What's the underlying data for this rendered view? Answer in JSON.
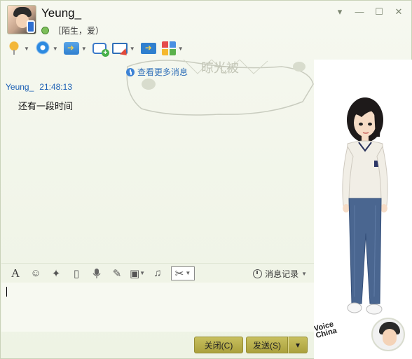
{
  "contact": {
    "nickname": "Yeung_",
    "signature": "［陌生，爱）"
  },
  "window_controls": [
    "▾",
    "—",
    "☐",
    "✕"
  ],
  "toolbar": {
    "items": [
      {
        "icon": "microphone-icon",
        "has_dropdown": true
      },
      {
        "icon": "webcam-icon",
        "has_dropdown": true
      },
      {
        "icon": "send-file-icon",
        "has_dropdown": true
      },
      {
        "icon": "create-group-chat-icon",
        "has_dropdown": false
      },
      {
        "icon": "remote-assist-icon",
        "has_dropdown": true
      },
      {
        "icon": "share-screen-icon",
        "has_dropdown": false
      },
      {
        "icon": "apps-icon",
        "has_dropdown": true
      }
    ]
  },
  "messages": {
    "more_link": "查看更多消息",
    "items": [
      {
        "sender": "Yeung_",
        "time": "21:48:13",
        "text": "还有一段时间"
      }
    ]
  },
  "input_toolbar": {
    "font_label": "A",
    "emoji": "☺",
    "shake": "✦",
    "film": "▯",
    "voice": "🎤",
    "edit": "✎",
    "image": "▣",
    "music": "♫",
    "scissors": "✂",
    "history_label": "消息记录"
  },
  "input": {
    "value": ""
  },
  "buttons": {
    "close_label": "关闭(C)",
    "send_label": "发送(S)",
    "send_more": "▾"
  },
  "decor": {
    "pillow_text": "晾光被"
  },
  "right_panel": {
    "logo_line1": "Voice",
    "logo_line2": "China"
  },
  "colors": {
    "accent_blue": "#1a5fb4",
    "button_olive": "#b5ab46",
    "background": "#f4f7ec"
  }
}
